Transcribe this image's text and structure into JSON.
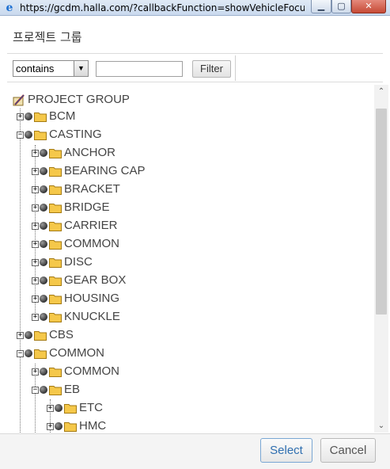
{
  "window": {
    "url": "https://gcdm.halla.com/?callbackFunction=showVehicleFocus&he...",
    "minimize_label": "▁",
    "maximize_label": "▢",
    "close_label": "✕"
  },
  "dialog": {
    "title": "프로젝트 그룹"
  },
  "filter": {
    "operator": "contains",
    "query": "",
    "button_label": "Filter"
  },
  "tree": {
    "root_label": "PROJECT GROUP",
    "nodes": [
      "BCM",
      "CASTING",
      "ANCHOR",
      "BEARING CAP",
      "BRACKET",
      "BRIDGE",
      "CARRIER",
      "COMMON",
      "DISC",
      "GEAR BOX",
      "HOUSING",
      "KNUCKLE",
      "CBS",
      "COMMON",
      "COMMON",
      "EB",
      "ETC",
      "HMC"
    ]
  },
  "footer": {
    "select_label": "Select",
    "cancel_label": "Cancel"
  },
  "colors": {
    "accent": "#2f6fb0",
    "folder": "#f5c84a",
    "titlebar": "#c9d9ee"
  }
}
